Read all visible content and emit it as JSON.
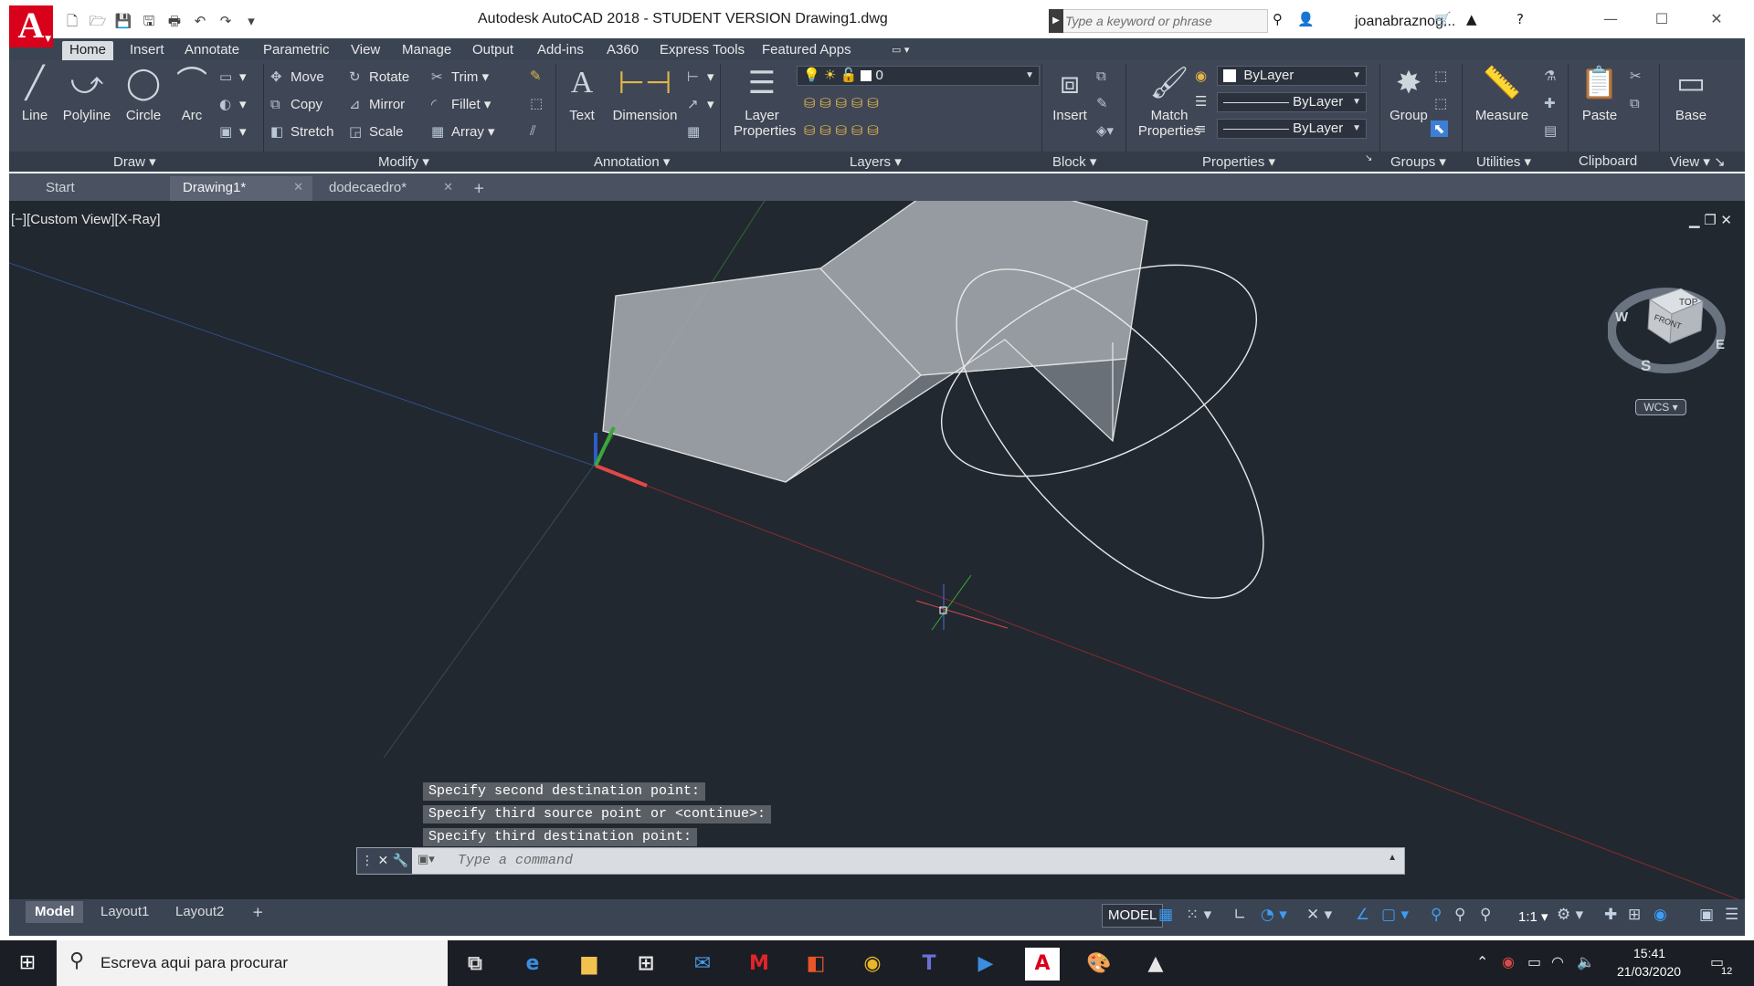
{
  "window": {
    "title": "Autodesk AutoCAD 2018 - STUDENT VERSION      Drawing1.dwg",
    "search_placeholder": "Type a keyword or phrase",
    "username": "joanabraznog...",
    "logo_letter": "A"
  },
  "ribbon": {
    "tabs": [
      "Home",
      "Insert",
      "Annotate",
      "Parametric",
      "View",
      "Manage",
      "Output",
      "Add-ins",
      "A360",
      "Express Tools",
      "Featured Apps"
    ],
    "active_tab": "Home",
    "panels": {
      "draw": {
        "title": "Draw",
        "line": "Line",
        "polyline": "Polyline",
        "circle": "Circle",
        "arc": "Arc"
      },
      "modify": {
        "title": "Modify",
        "move": "Move",
        "rotate": "Rotate",
        "trim": "Trim",
        "copy": "Copy",
        "mirror": "Mirror",
        "fillet": "Fillet",
        "stretch": "Stretch",
        "scale": "Scale",
        "array": "Array"
      },
      "annotation": {
        "title": "Annotation",
        "text": "Text",
        "dimension": "Dimension"
      },
      "layers": {
        "title": "Layers",
        "layer_properties": "Layer Properties",
        "current_layer": "0"
      },
      "block": {
        "title": "Block",
        "insert": "Insert"
      },
      "properties": {
        "title": "Properties",
        "match_properties": "Match Properties",
        "color": "ByLayer",
        "linetype": "ByLayer",
        "lineweight": "ByLayer"
      },
      "groups": {
        "title": "Groups",
        "group": "Group"
      },
      "utilities": {
        "title": "Utilities",
        "measure": "Measure"
      },
      "clipboard": {
        "title": "Clipboard",
        "paste": "Paste"
      },
      "view": {
        "title": "View",
        "base": "Base"
      }
    }
  },
  "doc_tabs": [
    {
      "label": "Start"
    },
    {
      "label": "Drawing1*"
    },
    {
      "label": "dodecaedro*"
    }
  ],
  "viewport": {
    "label": "[−][Custom View][X-Ray]",
    "controls": "▁ ❐ ✕"
  },
  "viewcube": {
    "top": "TOP",
    "front": "FRONT",
    "west": "W",
    "south": "S",
    "east": "E",
    "wcs": "WCS"
  },
  "command": {
    "history": [
      "Specify second destination point:",
      "Specify third source point or <continue>:",
      "Specify third destination point:"
    ],
    "placeholder": "Type a command"
  },
  "layout_tabs": [
    "Model",
    "Layout1",
    "Layout2"
  ],
  "status": {
    "model": "MODEL",
    "scale": "1:1"
  },
  "taskbar": {
    "search_text": "Escreva aqui para procurar",
    "time": "15:41",
    "date": "21/03/2020",
    "notifications": "12"
  }
}
